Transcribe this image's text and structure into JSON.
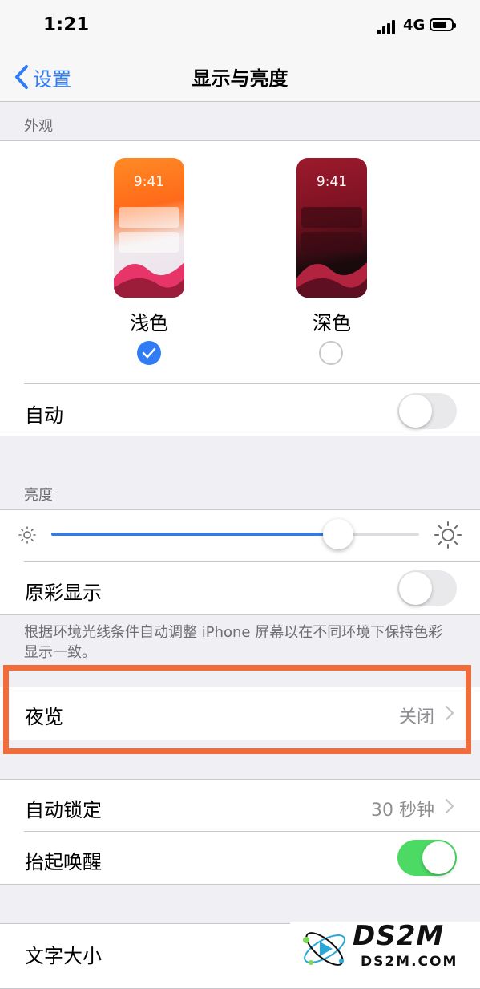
{
  "status": {
    "time": "1:21",
    "network": "4G"
  },
  "nav": {
    "back_label": "设置",
    "title": "显示与亮度"
  },
  "appearance": {
    "section_label": "外观",
    "light": {
      "mockup_time": "9:41",
      "label": "浅色",
      "selected": true
    },
    "dark": {
      "mockup_time": "9:41",
      "label": "深色",
      "selected": false
    },
    "automatic_label": "自动",
    "automatic_on": false
  },
  "brightness": {
    "section_label": "亮度",
    "level": 0.78,
    "true_tone_label": "原彩显示",
    "true_tone_on": false,
    "footer": "根据环境光线条件自动调整 iPhone 屏幕以在不同环境下保持色彩显示一致。"
  },
  "night_shift": {
    "label": "夜览",
    "value": "关闭"
  },
  "lock": {
    "auto_lock_label": "自动锁定",
    "auto_lock_value": "30 秒钟",
    "raise_to_wake_label": "抬起唤醒",
    "raise_to_wake_on": true
  },
  "text_size": {
    "label": "文字大小"
  },
  "watermark": {
    "title": "DS2M",
    "subtitle": "DS2M.COM"
  },
  "colors": {
    "accent": "#2f7cf6",
    "switch_on": "#4cd964",
    "highlight": "#f26b3a"
  },
  "icons": [
    "chevron-left-icon",
    "checkmark-icon",
    "brightness-low-icon",
    "brightness-high-icon",
    "chevron-right-icon",
    "signal-icon",
    "battery-icon",
    "ds2m-logo-icon"
  ]
}
